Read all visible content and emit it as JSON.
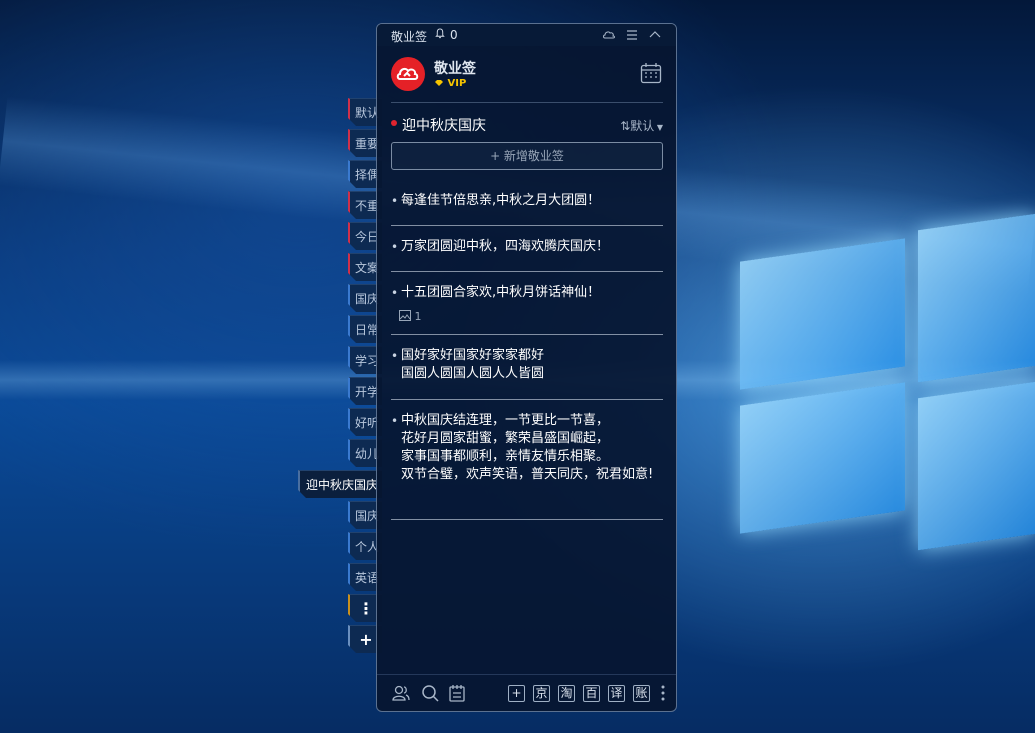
{
  "window": {
    "app_name": "敬业签",
    "notification_count": "0"
  },
  "user": {
    "name": "敬业签",
    "badge": "VIP"
  },
  "category": {
    "name": "迎中秋庆国庆",
    "sort_label": "默认",
    "add_note_label": "+ 新增敬业签"
  },
  "notes": [
    {
      "text": "每逢佳节倍思亲,中秋之月大团圆！"
    },
    {
      "text": "万家团圆迎中秋，四海欢腾庆国庆！"
    },
    {
      "text": "十五团圆合家欢,中秋月饼话神仙！",
      "attachments": "1"
    },
    {
      "text": "国好家好国家好家家都好\n国圆人圆国人圆人人皆圆"
    },
    {
      "text": "中秋国庆结连理，一节更比一节喜，\n花好月圆家甜蜜，繁荣昌盛国崛起，\n家事国事都顺利，亲情友情乐相聚。\n双节合璧，欢声笑语，普天同庆，祝君如意!"
    }
  ],
  "side_tabs": [
    {
      "label": "默认",
      "accent": "red"
    },
    {
      "label": "重要",
      "accent": "red"
    },
    {
      "label": "择偶",
      "accent": "blue"
    },
    {
      "label": "不重",
      "accent": "red"
    },
    {
      "label": "今日",
      "accent": "red"
    },
    {
      "label": "文案",
      "accent": "red"
    },
    {
      "label": "国庆",
      "accent": "blue"
    },
    {
      "label": "日常",
      "accent": "blue"
    },
    {
      "label": "学习",
      "accent": "blue"
    },
    {
      "label": "开学",
      "accent": "blue"
    },
    {
      "label": "好听",
      "accent": "blue"
    },
    {
      "label": "幼儿",
      "accent": "blue"
    },
    {
      "label": "迎中秋庆国庆",
      "accent": "active"
    },
    {
      "label": "国庆",
      "accent": "blue"
    },
    {
      "label": "个人",
      "accent": "blue"
    },
    {
      "label": "英语",
      "accent": "blue"
    }
  ],
  "side_tools": {
    "more": "⋮",
    "add": "+"
  },
  "footer": {
    "shortcuts": [
      "+",
      "京",
      "淘",
      "百",
      "译",
      "账"
    ]
  },
  "colors": {
    "accent_red": "#e52127",
    "vip_gold": "#f5c400",
    "panel_bg": "#061630"
  }
}
